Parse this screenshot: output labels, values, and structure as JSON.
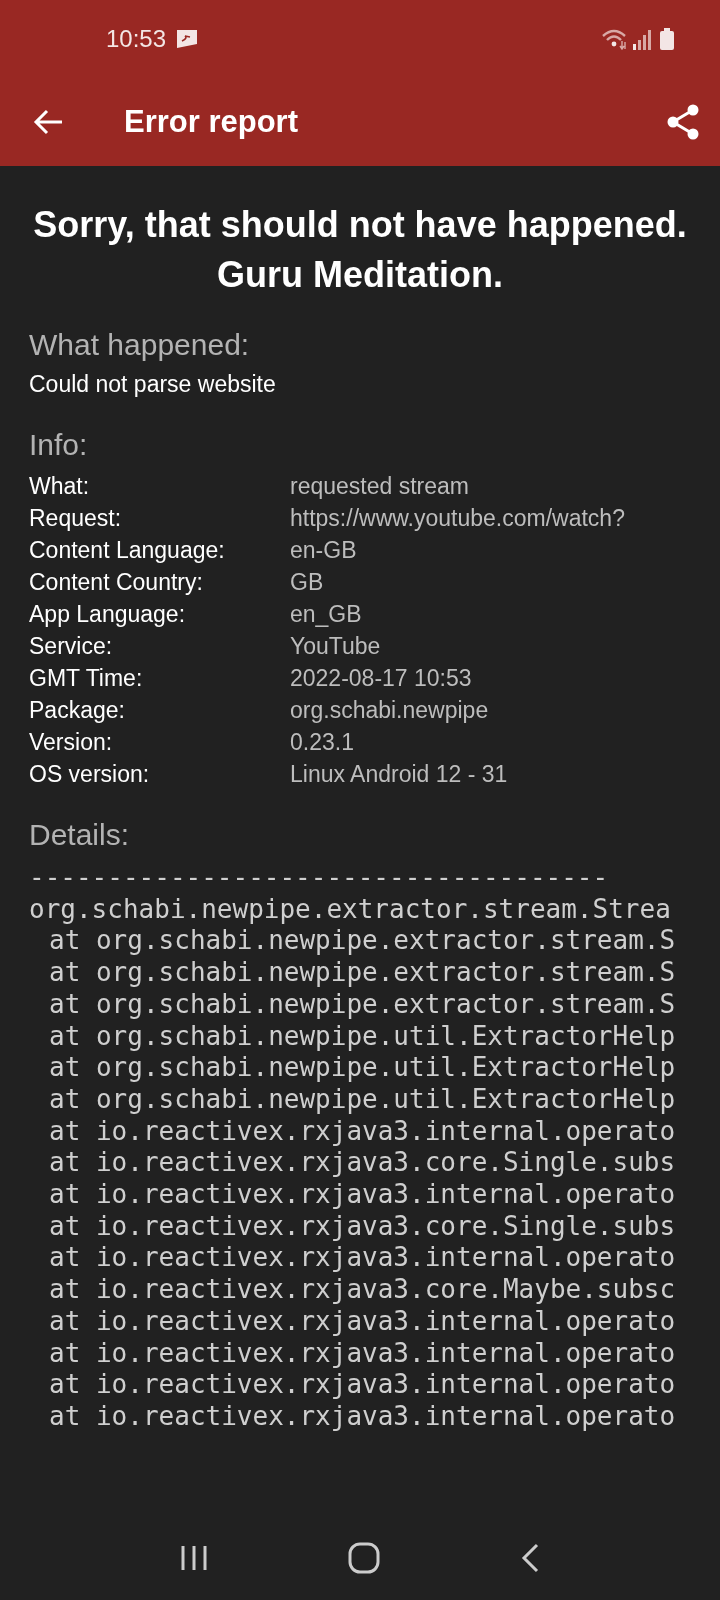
{
  "status_bar": {
    "time": "10:53"
  },
  "app_bar": {
    "title": "Error report"
  },
  "headline": [
    "Sorry, that should not have happened.",
    "Guru Meditation."
  ],
  "what_happened": {
    "heading": "What happened:",
    "text": "Could not parse website"
  },
  "info": {
    "heading": "Info:",
    "rows": [
      {
        "label": "What:",
        "value": "requested stream"
      },
      {
        "label": "Request:",
        "value": "https://www.youtube.com/watch?"
      },
      {
        "label": "Content Language:",
        "value": "en-GB"
      },
      {
        "label": "Content Country:",
        "value": "GB"
      },
      {
        "label": "App Language:",
        "value": "en_GB"
      },
      {
        "label": "Service:",
        "value": "YouTube"
      },
      {
        "label": "GMT Time:",
        "value": "2022-08-17 10:53"
      },
      {
        "label": "Package:",
        "value": "org.schabi.newpipe"
      },
      {
        "label": "Version:",
        "value": "0.23.1"
      },
      {
        "label": "OS version:",
        "value": "Linux Android 12 - 31"
      }
    ]
  },
  "details": {
    "heading": "Details:",
    "lines": [
      {
        "kind": "plain",
        "text": "-------------------------------------"
      },
      {
        "kind": "plain",
        "text": "org.schabi.newpipe.extractor.stream.Strea"
      },
      {
        "kind": "frame",
        "text": "at org.schabi.newpipe.extractor.stream.S"
      },
      {
        "kind": "frame",
        "text": "at org.schabi.newpipe.extractor.stream.S"
      },
      {
        "kind": "frame",
        "text": "at org.schabi.newpipe.extractor.stream.S"
      },
      {
        "kind": "frame",
        "text": "at org.schabi.newpipe.util.ExtractorHelp"
      },
      {
        "kind": "frame",
        "text": "at org.schabi.newpipe.util.ExtractorHelp"
      },
      {
        "kind": "frame",
        "text": "at org.schabi.newpipe.util.ExtractorHelp"
      },
      {
        "kind": "frame",
        "text": "at io.reactivex.rxjava3.internal.operato"
      },
      {
        "kind": "frame",
        "text": "at io.reactivex.rxjava3.core.Single.subs"
      },
      {
        "kind": "frame",
        "text": "at io.reactivex.rxjava3.internal.operato"
      },
      {
        "kind": "frame",
        "text": "at io.reactivex.rxjava3.core.Single.subs"
      },
      {
        "kind": "frame",
        "text": "at io.reactivex.rxjava3.internal.operato"
      },
      {
        "kind": "frame",
        "text": "at io.reactivex.rxjava3.core.Maybe.subsc"
      },
      {
        "kind": "frame",
        "text": "at io.reactivex.rxjava3.internal.operato"
      },
      {
        "kind": "frame",
        "text": "at io.reactivex.rxjava3.internal.operato"
      },
      {
        "kind": "frame",
        "text": "at io.reactivex.rxjava3.internal.operato"
      },
      {
        "kind": "frame",
        "text": "at io.reactivex.rxjava3.internal.operato"
      }
    ]
  }
}
